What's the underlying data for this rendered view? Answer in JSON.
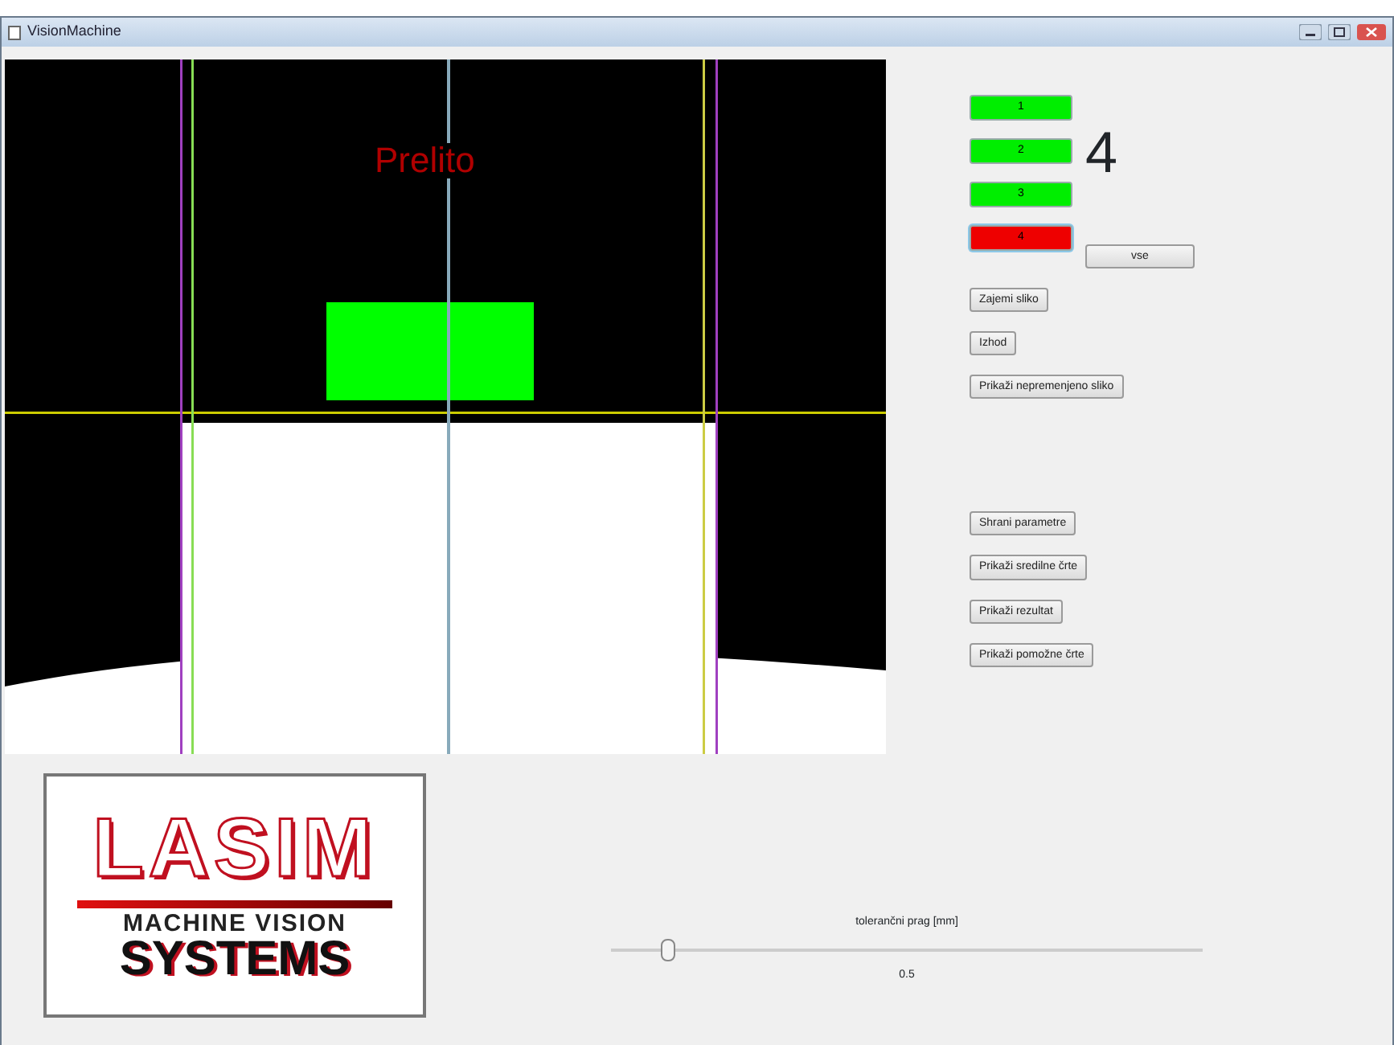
{
  "window": {
    "title": "VisionMachine"
  },
  "camera_view": {
    "overlay_label": "Prelito"
  },
  "indicators": [
    {
      "label": "1",
      "ok": true
    },
    {
      "label": "2",
      "ok": true
    },
    {
      "label": "3",
      "ok": true
    },
    {
      "label": "4",
      "ok": false
    }
  ],
  "count": "4",
  "all_button": "vse",
  "buttons_top": [
    "Zajemi sliko",
    "Izhod",
    "Prikaži nepremenjeno sliko"
  ],
  "buttons_bottom": [
    "Shrani parametre",
    "Prikaži sredilne črte",
    "Prikaži rezultat",
    "Prikaži pomožne črte"
  ],
  "logo": {
    "name": "LASIM",
    "line1": "MACHINE VISION",
    "line2": "SYSTEMS"
  },
  "slider": {
    "label": "tolerančni prag [mm]",
    "level": 0.095,
    "value": "0.5"
  }
}
